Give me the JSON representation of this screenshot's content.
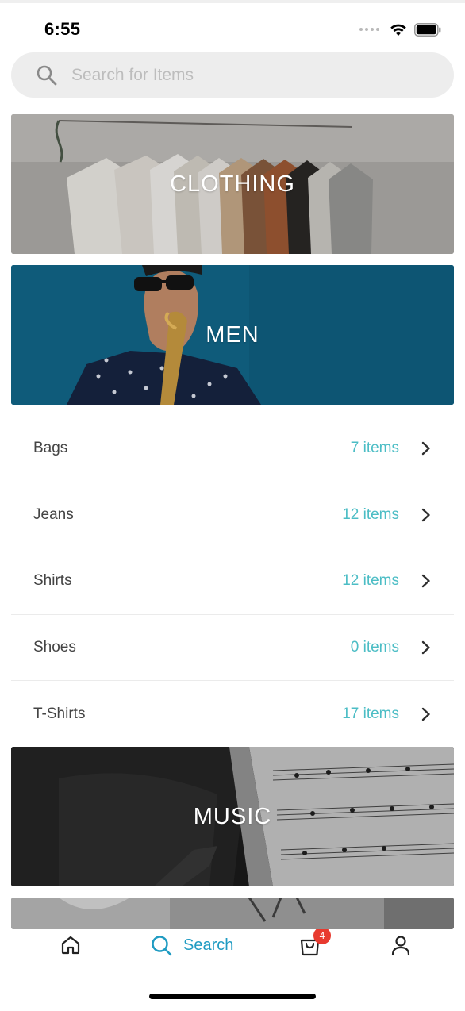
{
  "status_bar": {
    "time": "6:55",
    "icons": [
      "signal-dots",
      "wifi-icon",
      "battery-icon"
    ]
  },
  "search": {
    "placeholder": "Search for Items",
    "icon": "search-icon"
  },
  "categories": [
    {
      "title": "CLOTHING"
    },
    {
      "title": "MEN"
    },
    {
      "title": "MUSIC"
    }
  ],
  "men_subcategories": [
    {
      "name": "Bags",
      "count": "7 items"
    },
    {
      "name": "Jeans",
      "count": "12 items"
    },
    {
      "name": "Shirts",
      "count": "12 items"
    },
    {
      "name": "Shoes",
      "count": "0 items"
    },
    {
      "name": "T-Shirts",
      "count": "17 items"
    }
  ],
  "tab_bar": {
    "home_icon": "home-icon",
    "search_label": "Search",
    "cart_badge": "4",
    "account_icon": "user-icon",
    "active_color": "#1f9bc2"
  },
  "colors": {
    "accent": "#4cbdc5",
    "badge": "#e83a2f",
    "men_banner": "#0f5876"
  }
}
